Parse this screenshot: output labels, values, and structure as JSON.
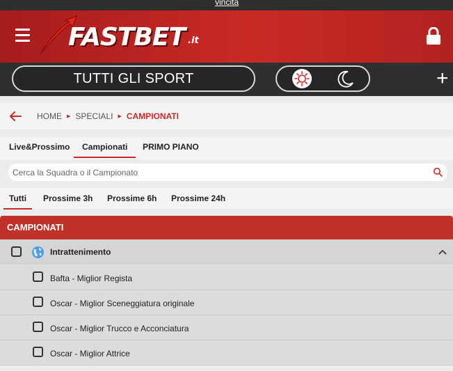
{
  "top_link": "vincita",
  "header": {
    "logo_text": "FASTBET",
    "logo_tld": ".it"
  },
  "sport_bar": {
    "all_sports_label": "TUTTI GLI SPORT",
    "add_label": "+"
  },
  "breadcrumb": {
    "items": [
      "HOME",
      "SPECIALI",
      "CAMPIONATI"
    ]
  },
  "tabs": [
    "Live&Prossimo",
    "Campionati",
    "PRIMO PIANO"
  ],
  "search": {
    "placeholder": "Cerca la Squadra o il Campionato"
  },
  "time_filters": [
    "Tutti",
    "Prossime 3h",
    "Prossime 6h",
    "Prossime 24h"
  ],
  "section_title": "CAMPIONATI",
  "group": {
    "name": "Intrattenimento",
    "items": [
      "Bafta - Miglior Regista",
      "Oscar - Miglior Sceneggiatura originale",
      "Oscar - Miglior Trucco e Acconciatura",
      "Oscar - Miglior Attrice"
    ]
  },
  "colors": {
    "brand_red": "#c0312a",
    "dark_bar": "#2f2f2f",
    "accent_red": "#c52a26"
  }
}
